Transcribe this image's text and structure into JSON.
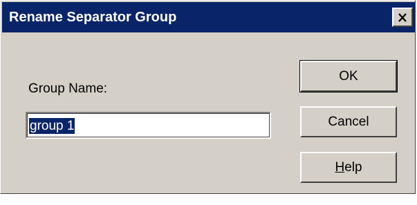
{
  "window": {
    "title": "Rename Separator Group",
    "close_icon": "close-icon"
  },
  "form": {
    "group_name_label": "Group Name:",
    "group_name_value": "group 1"
  },
  "buttons": {
    "ok_label": "OK",
    "cancel_label": "Cancel",
    "help_mnemonic": "H",
    "help_rest": "elp"
  },
  "colors": {
    "titlebar": "#0a246a",
    "dialog_face": "#d4d0c8",
    "selection": "#0a246a"
  }
}
